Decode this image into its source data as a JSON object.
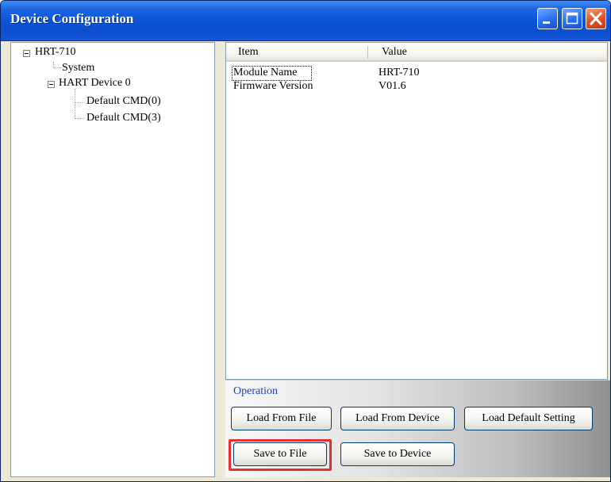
{
  "window": {
    "title": "Device Configuration",
    "controls": {
      "minimize": "minimize-icon",
      "maximize": "maximize-icon",
      "close": "close-icon"
    }
  },
  "tree": {
    "root": "HRT-710",
    "system": "System",
    "device": "HART Device 0",
    "cmd0": "Default CMD(0)",
    "cmd3": "Default CMD(3)"
  },
  "table": {
    "headers": [
      "Item",
      "Value"
    ],
    "rows": [
      {
        "item": "Module Name",
        "value": "HRT-710"
      },
      {
        "item": "Firmware Version",
        "value": "V01.6"
      }
    ]
  },
  "operation": {
    "label": "Operation",
    "load_from_file": "Load From File",
    "load_from_device": "Load From Device",
    "load_default": "Load Default Setting",
    "save_to_file": "Save to File",
    "save_to_device": "Save to Device"
  },
  "colors": {
    "title_bar": "#0a52d6",
    "highlight": "#e53030",
    "operation_label": "#1f3fbf"
  }
}
